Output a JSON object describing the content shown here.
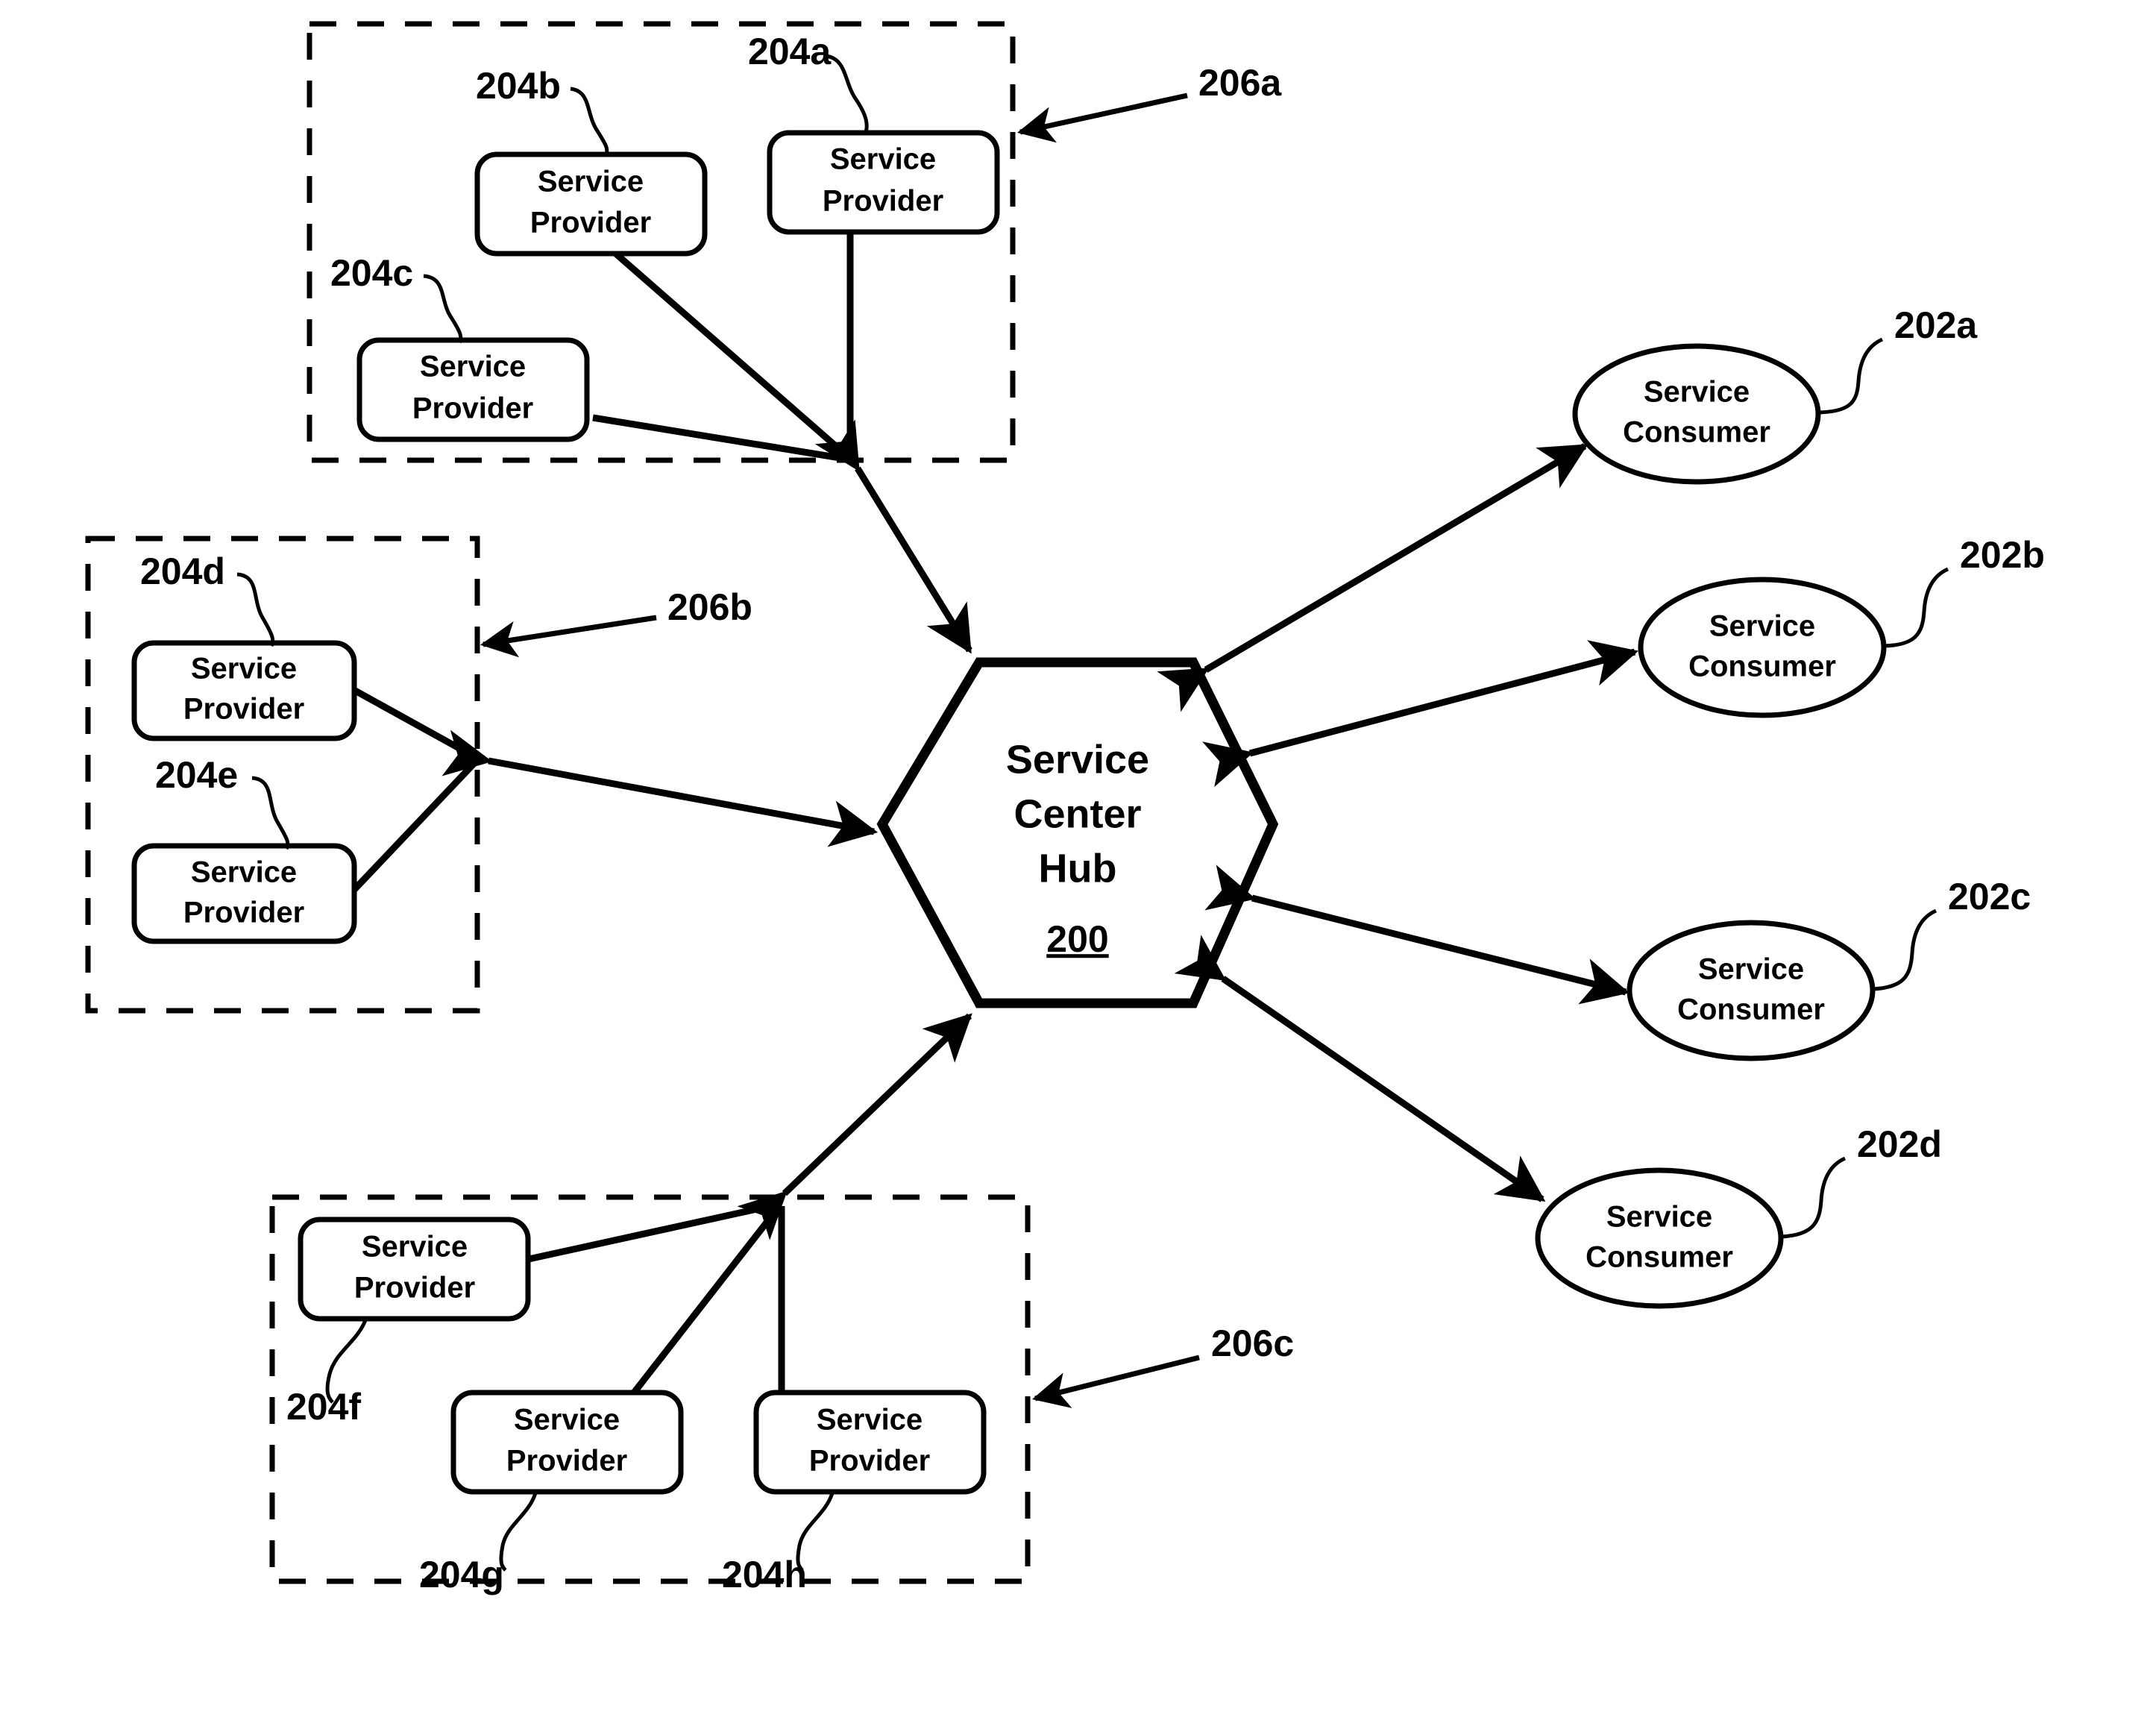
{
  "figure": {
    "title": "Service Center Hub architecture diagram",
    "background_color": "#ffffff",
    "line_color": "#000000"
  },
  "hub": {
    "line1": "Service",
    "line2": "Center",
    "line3": "Hub",
    "reference": "200",
    "shape": "hexagon"
  },
  "consumers": [
    {
      "line1": "Service",
      "line2": "Consumer",
      "reference": "202a",
      "shape": "ellipse"
    },
    {
      "line1": "Service",
      "line2": "Consumer",
      "reference": "202b",
      "shape": "ellipse"
    },
    {
      "line1": "Service",
      "line2": "Consumer",
      "reference": "202c",
      "shape": "ellipse"
    },
    {
      "line1": "Service",
      "line2": "Consumer",
      "reference": "202d",
      "shape": "ellipse"
    }
  ],
  "provider_groups": [
    {
      "reference": "206a",
      "shape": "dashed-box",
      "providers": [
        {
          "line1": "Service",
          "line2": "Provider",
          "reference": "204a"
        },
        {
          "line1": "Service",
          "line2": "Provider",
          "reference": "204b"
        },
        {
          "line1": "Service",
          "line2": "Provider",
          "reference": "204c"
        }
      ]
    },
    {
      "reference": "206b",
      "shape": "dashed-box",
      "providers": [
        {
          "line1": "Service",
          "line2": "Provider",
          "reference": "204d"
        },
        {
          "line1": "Service",
          "line2": "Provider",
          "reference": "204e"
        }
      ]
    },
    {
      "reference": "206c",
      "shape": "dashed-box",
      "providers": [
        {
          "line1": "Service",
          "line2": "Provider",
          "reference": "204f"
        },
        {
          "line1": "Service",
          "line2": "Provider",
          "reference": "204g"
        },
        {
          "line1": "Service",
          "line2": "Provider",
          "reference": "204h"
        }
      ]
    }
  ],
  "connections": [
    {
      "from": "206a",
      "to": "200",
      "arrow": "bidirectional"
    },
    {
      "from": "206b",
      "to": "200",
      "arrow": "bidirectional"
    },
    {
      "from": "206c",
      "to": "200",
      "arrow": "bidirectional"
    },
    {
      "from": "200",
      "to": "202a",
      "arrow": "bidirectional"
    },
    {
      "from": "200",
      "to": "202b",
      "arrow": "bidirectional"
    },
    {
      "from": "200",
      "to": "202c",
      "arrow": "bidirectional"
    },
    {
      "from": "200",
      "to": "202d",
      "arrow": "bidirectional"
    }
  ]
}
